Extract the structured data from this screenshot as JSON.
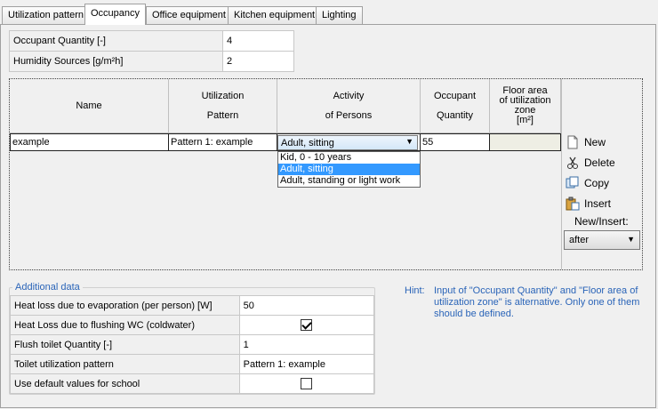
{
  "tabs": [
    {
      "label": "Utilization pattern"
    },
    {
      "label": "Occupancy"
    },
    {
      "label": "Office equipment"
    },
    {
      "label": "Kitchen equipment"
    },
    {
      "label": "Lighting"
    }
  ],
  "active_tab": "Occupancy",
  "summary": {
    "occupant_quantity": {
      "label": "Occupant Quantity  [-]",
      "value": "4"
    },
    "humidity_sources": {
      "label": "Humidity Sources  [g/m²h]",
      "value": "2"
    }
  },
  "table": {
    "headers": {
      "name": "Name",
      "pattern_l1": "Utilization",
      "pattern_l2": "Pattern",
      "activity_l1": "Activity",
      "activity_l2": "of Persons",
      "qty_l1": "Occupant",
      "qty_l2": "Quantity",
      "floor_l1": "Floor area",
      "floor_l2": "of utilization",
      "floor_l3": "zone",
      "floor_l4": "[m²]"
    },
    "row": {
      "name": "example",
      "pattern": "Pattern 1: example",
      "activity": "Adult, sitting",
      "quantity": "55",
      "floor_area": ""
    },
    "activity_options": [
      "Kid, 0 - 10 years",
      "Adult, sitting",
      "Adult, standing or light work"
    ],
    "activity_selected_index": 1
  },
  "side_actions": {
    "new": "New",
    "delete": "Delete",
    "copy": "Copy",
    "insert": "Insert",
    "new_insert_label": "New/Insert:",
    "new_insert_value": "after"
  },
  "additional": {
    "title": "Additional data",
    "rows": [
      {
        "label": "Heat loss due to evaporation (per person)  [W]",
        "value": "50"
      },
      {
        "label": "Heat Loss due to flushing WC (coldwater)",
        "checked": true
      },
      {
        "label": "Flush toilet Quantity  [-]",
        "value": "1"
      },
      {
        "label": "Toilet utilization pattern",
        "value": "Pattern 1: example"
      },
      {
        "label": "Use default values for school",
        "checked": false
      }
    ]
  },
  "hint": {
    "label": "Hint:",
    "text": "Input of \"Occupant Quantity\" and  \"Floor area of utilization zone\" is alternative. Only one of them should be defined."
  },
  "colors": {
    "accent_text": "#2a64b8",
    "selection": "#3399ff",
    "disabled_cell": "#eeeee4"
  }
}
